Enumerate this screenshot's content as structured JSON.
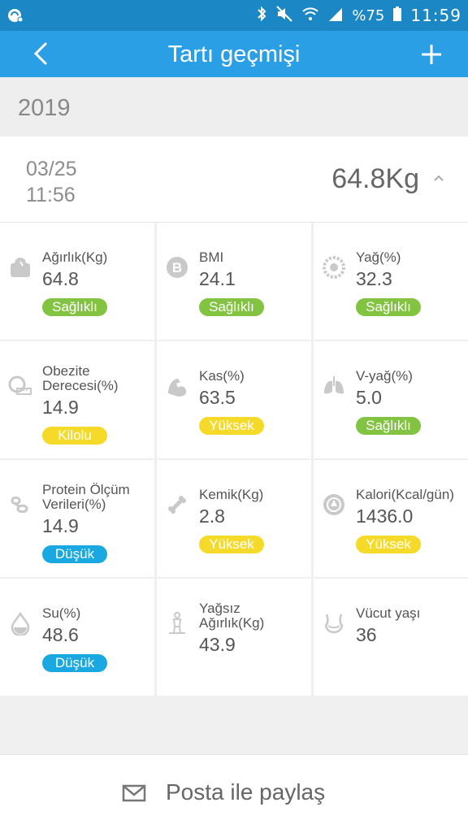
{
  "status_bar": {
    "battery_percent": "%75",
    "time": "11:59",
    "icons": [
      "notification-icon",
      "bluetooth-icon",
      "mute-icon",
      "wifi-icon",
      "signal-icon",
      "battery-icon"
    ]
  },
  "header": {
    "title": "Tartı geçmişi",
    "back_icon": "chevron-left-icon",
    "add_icon": "plus-icon"
  },
  "year": "2019",
  "record": {
    "date": "03/25",
    "time": "11:56",
    "weight": "64.8Kg"
  },
  "metrics": [
    {
      "label": "Ağırlık(Kg)",
      "value": "64.8",
      "badge": "Sağlıklı",
      "badge_color": "#82c341",
      "icon": "scale-icon"
    },
    {
      "label": "BMI",
      "value": "24.1",
      "badge": "Sağlıklı",
      "badge_color": "#82c341",
      "icon": "bmi-icon"
    },
    {
      "label": "Yağ(%)",
      "value": "32.3",
      "badge": "Sağlıklı",
      "badge_color": "#82c341",
      "icon": "fat-icon"
    },
    {
      "label": "Obezite\nDerecesi(%)",
      "value": "14.9",
      "badge": "Kilolu",
      "badge_color": "#f6da2a",
      "icon": "tape-measure-icon"
    },
    {
      "label": "Kas(%)",
      "value": "63.5",
      "badge": "Yüksek",
      "badge_color": "#f6da2a",
      "icon": "muscle-icon"
    },
    {
      "label": "V-yağ(%)",
      "value": "5.0",
      "badge": "Sağlıklı",
      "badge_color": "#82c341",
      "icon": "lungs-icon"
    },
    {
      "label": "Protein Ölçüm\nVerileri(%)",
      "value": "14.9",
      "badge": "Düşük",
      "badge_color": "#1aa8e3",
      "icon": "protein-icon"
    },
    {
      "label": "Kemik(Kg)",
      "value": "2.8",
      "badge": "Yüksek",
      "badge_color": "#f6da2a",
      "icon": "bone-icon"
    },
    {
      "label": "Kalori(Kcal/gün)",
      "value": "1436.0",
      "badge": "Yüksek",
      "badge_color": "#f6da2a",
      "icon": "calorie-icon"
    },
    {
      "label": "Su(%)",
      "value": "48.6",
      "badge": "Düşük",
      "badge_color": "#1aa8e3",
      "icon": "water-drop-icon"
    },
    {
      "label": "Yağsız\nAğırlık(Kg)",
      "value": "43.9",
      "badge": "",
      "badge_color": "",
      "icon": "lean-body-icon"
    },
    {
      "label": "Vücut yaşı",
      "value": "36",
      "badge": "",
      "badge_color": "",
      "icon": "body-age-icon"
    }
  ],
  "share": {
    "label": "Posta ile paylaş",
    "icon": "mail-icon"
  },
  "colors": {
    "status_bar": "#1c87c5",
    "header": "#2a9fe6",
    "healthy": "#82c341",
    "warning": "#f6da2a",
    "low": "#1aa8e3"
  }
}
